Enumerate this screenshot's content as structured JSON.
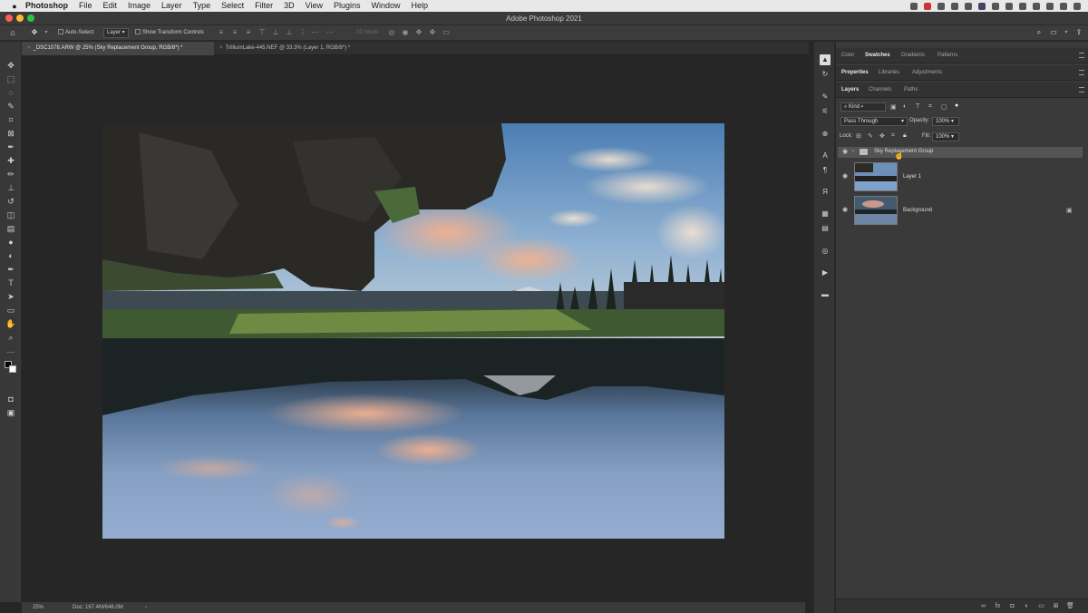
{
  "menubar": {
    "app_name": "Photoshop",
    "menus": [
      "File",
      "Edit",
      "Image",
      "Layer",
      "Type",
      "Select",
      "Filter",
      "3D",
      "View",
      "Plugins",
      "Window",
      "Help"
    ]
  },
  "window": {
    "title": "Adobe Photoshop 2021"
  },
  "options_bar": {
    "auto_select_label": "Auto-Select:",
    "auto_select_target": "Layer",
    "show_transform_label": "Show Transform Controls",
    "mode_3d_label": "3D Mode:"
  },
  "document_tabs": [
    {
      "label": "_DSC1078.ARW @ 25% (Sky Replacement Group, RGB/8*) *",
      "active": true
    },
    {
      "label": "TrilliumLake-445.NEF @ 33.3% (Layer 1, RGB/8*) *",
      "active": false
    }
  ],
  "status_bar": {
    "zoom": "25%",
    "doc_info": "Doc: 167.4M/646.0M"
  },
  "panels": {
    "top_tabs": [
      "Color",
      "Swatches",
      "Gradients",
      "Patterns"
    ],
    "top_active": "Swatches",
    "mid_tabs": [
      "Properties",
      "Libraries",
      "Adjustments"
    ],
    "mid_active": "Properties",
    "layer_tabs": [
      "Layers",
      "Channels",
      "Paths"
    ],
    "layer_active": "Layers",
    "filter_kind": "Kind",
    "blend_mode": "Pass Through",
    "opacity_label": "Opacity:",
    "opacity_value": "100%",
    "lock_label": "Lock:",
    "fill_label": "Fill:",
    "fill_value": "100%",
    "layers": [
      {
        "name": "Sky Replacement Group",
        "type": "group",
        "visible": true,
        "selected": true
      },
      {
        "name": "Layer 1",
        "type": "pixel",
        "visible": true,
        "selected": false
      },
      {
        "name": "Background",
        "type": "background",
        "visible": true,
        "locked": true,
        "selected": false
      }
    ]
  },
  "colors": {
    "accent_red": "#ff5f57",
    "accent_yellow": "#febc2e",
    "accent_green": "#28c840"
  }
}
